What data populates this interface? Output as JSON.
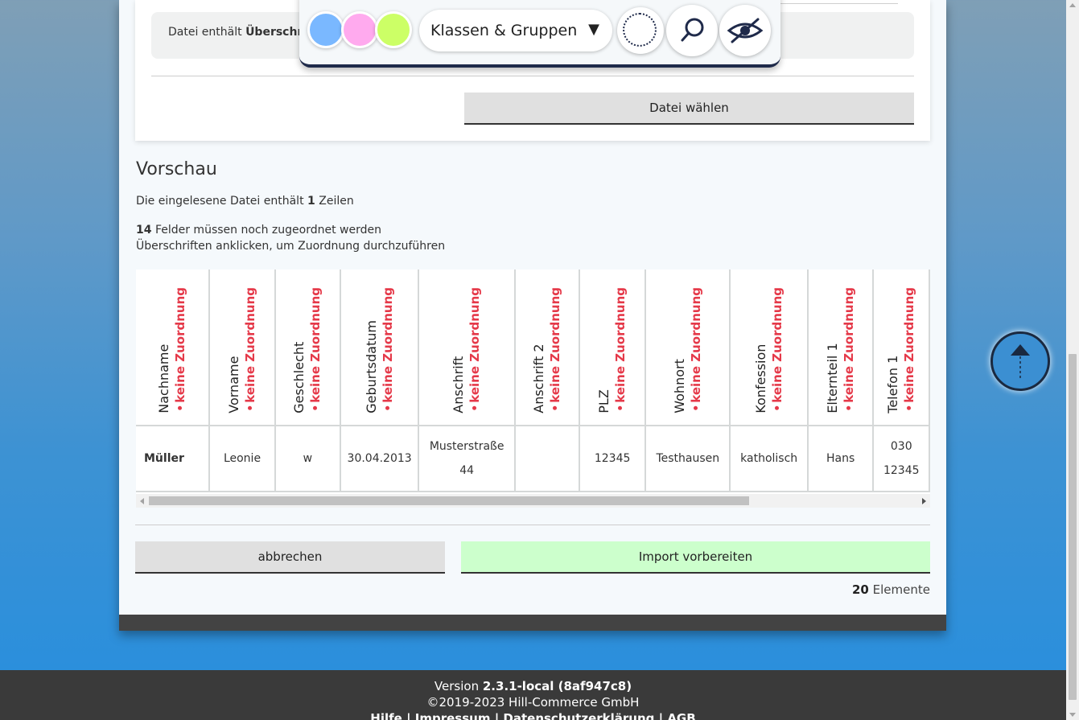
{
  "upload": {
    "file_contains_prefix": "Datei enthält",
    "file_contains_bold": "Überschr",
    "choose_file_button": "Datei wählen"
  },
  "toolbar": {
    "swatch_colors": [
      "#7ab8ff",
      "#ffaaee",
      "#ccff66"
    ],
    "select_value": "Klassen & Gruppen",
    "caret": "▼",
    "buttons": [
      "dotted-circle-icon",
      "search-icon",
      "eye-slash-icon"
    ]
  },
  "preview": {
    "title": "Vorschau",
    "rows_prefix": "Die eingelesene Datei enthält",
    "rows_count": "1",
    "rows_suffix": "Zeilen",
    "fields_count": "14",
    "fields_text": "Felder müssen noch zugeordnet werden",
    "hint_text": "Überschriften anklicken, um Zuordnung durchzuführen",
    "columns": [
      {
        "name": "Nachname",
        "assign": "keine Zuordnung"
      },
      {
        "name": "Vorname",
        "assign": "keine Zuordnung"
      },
      {
        "name": "Geschlecht",
        "assign": "keine Zuordnung"
      },
      {
        "name": "Geburtsdatum",
        "assign": "keine Zuordnung"
      },
      {
        "name": "Anschrift",
        "assign": "keine Zuordnung"
      },
      {
        "name": "Anschrift 2",
        "assign": "keine Zuordnung"
      },
      {
        "name": "PLZ",
        "assign": "keine Zuordnung"
      },
      {
        "name": "Wohnort",
        "assign": "keine Zuordnung"
      },
      {
        "name": "Konfession",
        "assign": "keine Zuordnung"
      },
      {
        "name": "Elternteil 1",
        "assign": "keine Zuordnung"
      },
      {
        "name": "Telefon 1",
        "assign": "keine Zuordnung"
      }
    ],
    "row": [
      "Müller",
      "Leonie",
      "w",
      "30.04.2013",
      "Musterstraße 44",
      "",
      "12345",
      "Testhausen",
      "katholisch",
      "Hans",
      "030 12345"
    ]
  },
  "actions": {
    "cancel": "abbrechen",
    "import": "Import vorbereiten",
    "elements_count": "20",
    "elements_label": "Elemente"
  },
  "footer": {
    "version_prefix": "Version",
    "version": "2.3.1-local (8af947c8)",
    "copyright": "©2019-2023 Hill-Commerce GmbH",
    "links": [
      "Hilfe",
      "Impressum",
      "Datenschutzerklärung",
      "AGB"
    ]
  },
  "colors": {
    "accent_red": "#e53949",
    "import_green": "#ccffcc",
    "navy": "#1f2a4a"
  }
}
